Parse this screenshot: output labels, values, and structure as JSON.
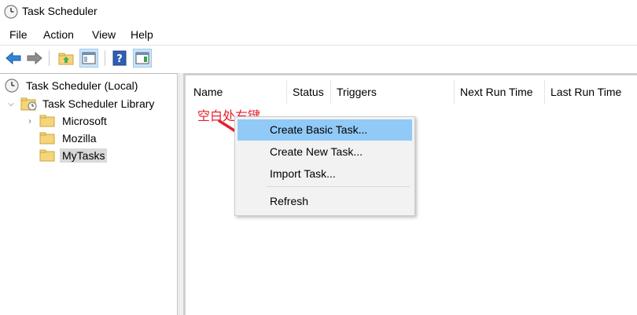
{
  "window": {
    "title": "Task Scheduler",
    "icon": "clock-icon"
  },
  "menu": [
    "File",
    "Action",
    "View",
    "Help"
  ],
  "toolbar": {
    "buttons": [
      {
        "name": "back-button",
        "icon": "back-arrow-icon"
      },
      {
        "name": "forward-button",
        "icon": "forward-arrow-icon"
      },
      {
        "name": "up-folder-button",
        "icon": "folder-up-icon"
      },
      {
        "name": "show-hide-console-tree-button",
        "icon": "console-tree-icon"
      },
      {
        "name": "help-button",
        "icon": "help-icon"
      },
      {
        "name": "show-hide-action-pane-button",
        "icon": "action-pane-icon"
      }
    ]
  },
  "tree": {
    "root": "Task Scheduler (Local)",
    "library": "Task Scheduler Library",
    "children": [
      "Microsoft",
      "Mozilla",
      "MyTasks"
    ],
    "selected": "MyTasks"
  },
  "columns": [
    "Name",
    "Status",
    "Triggers",
    "Next Run Time",
    "Last Run Time"
  ],
  "annotation": {
    "text": "空白处右键",
    "color": "#e61e2e"
  },
  "context_menu": {
    "items": [
      "Create Basic Task...",
      "Create New Task...",
      "Import Task...",
      "Refresh"
    ],
    "highlighted": "Create Basic Task..."
  },
  "colors": {
    "selection_highlight": "#91c9f7",
    "tree_selected": "#d9d9d9",
    "folder": "#f6d47a"
  }
}
